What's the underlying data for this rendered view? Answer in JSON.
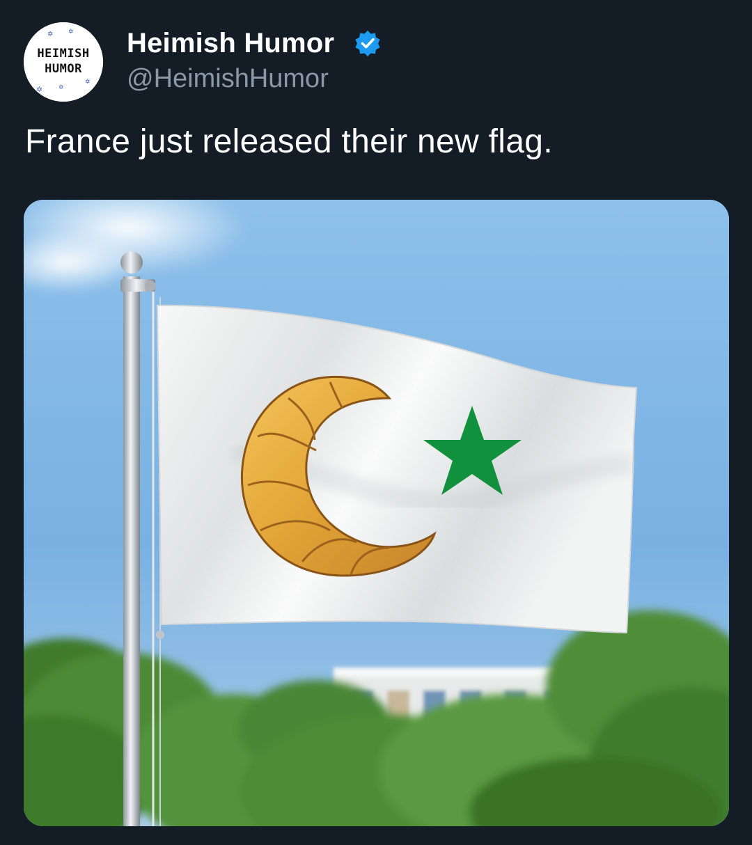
{
  "author": {
    "display_name": "Heimish Humor",
    "handle": "@HeimishHumor",
    "verified": true,
    "avatar_lines": [
      "HEIMISH",
      "HUMOR"
    ],
    "verified_color": "#1d9bf0"
  },
  "tweet": {
    "text": "France just released their new flag."
  },
  "media": {
    "icon": "flag-photo",
    "flag_color": "#f4f5f4",
    "star_color": "#11913d",
    "sky_color": "#7fb6e6"
  }
}
